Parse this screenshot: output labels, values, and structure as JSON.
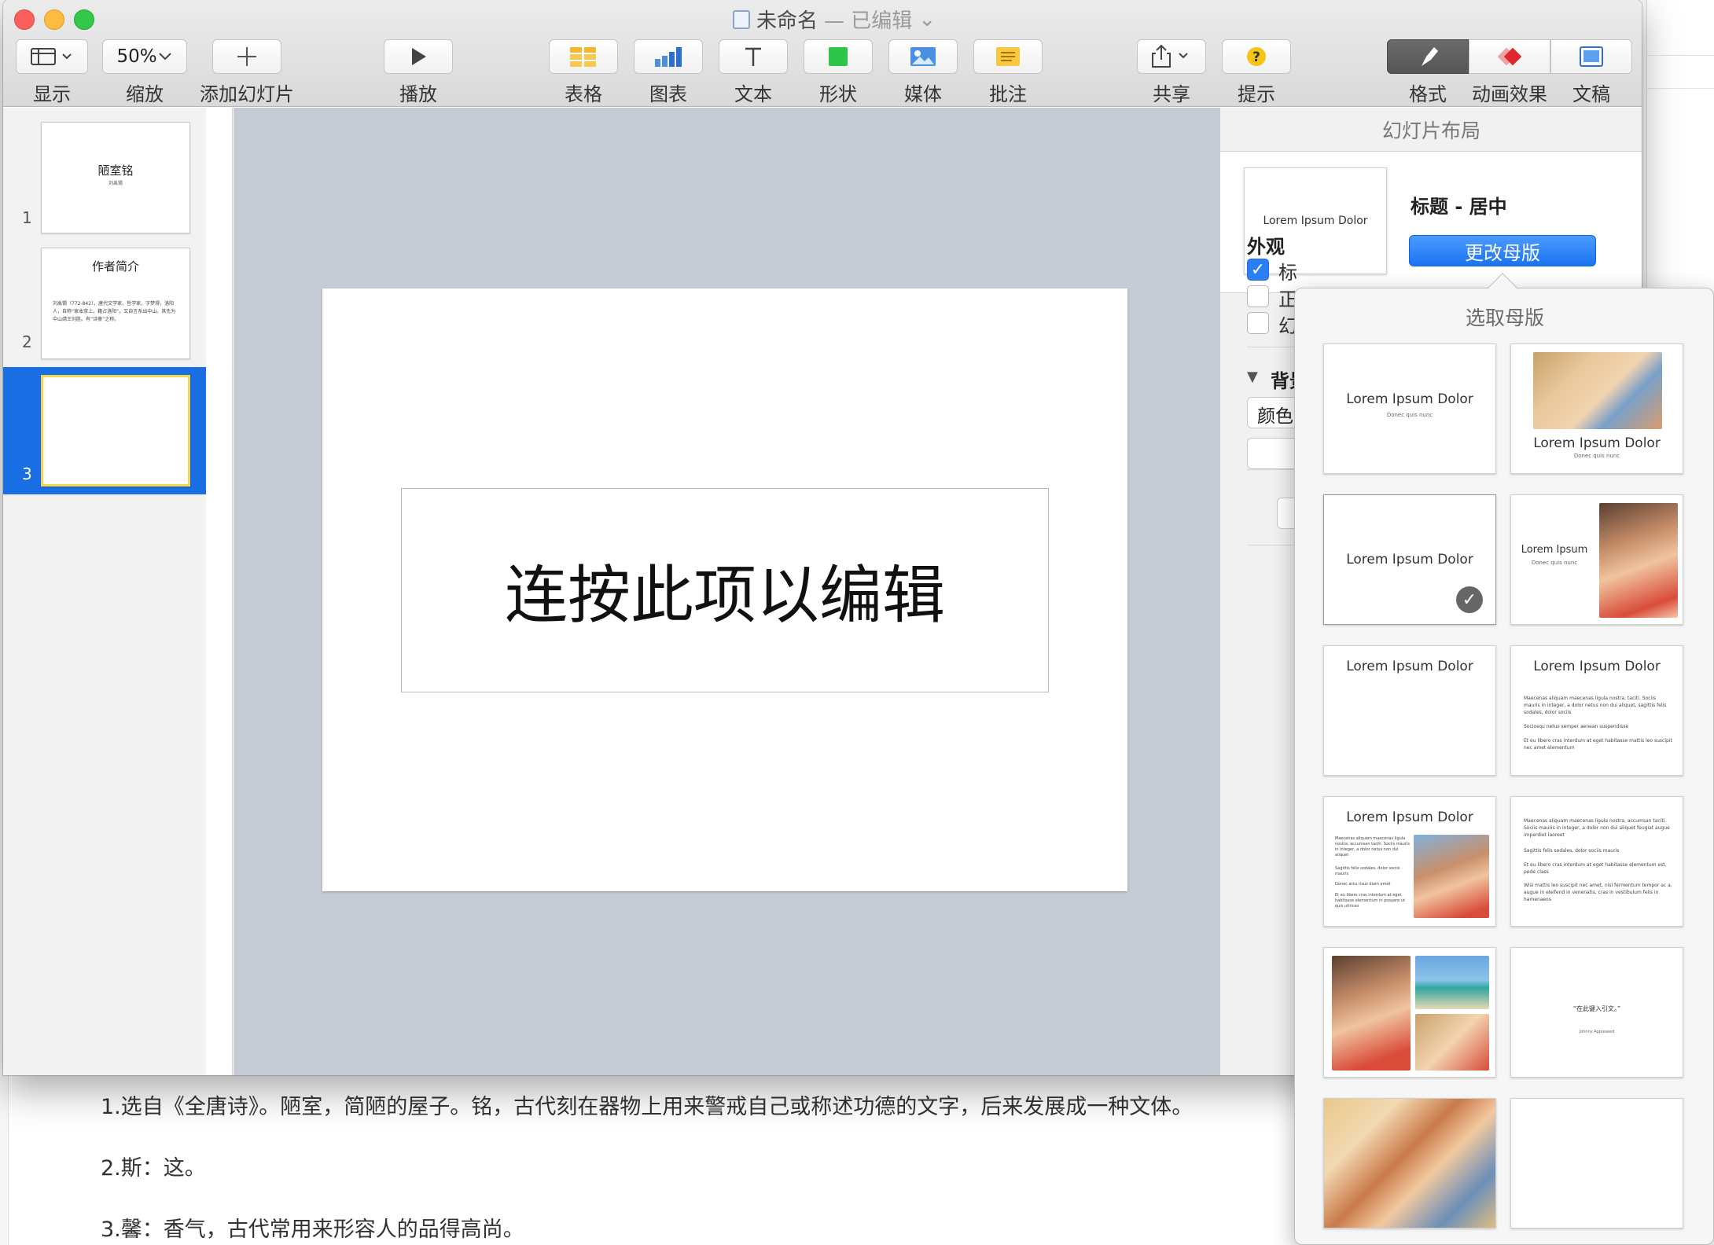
{
  "window": {
    "title": "未命名",
    "title_state": "— 已编辑",
    "title_chevron": "⌄"
  },
  "toolbar": {
    "view_label": "显示",
    "zoom_value": "50%",
    "zoom_label": "缩放",
    "add_slide_label": "添加幻灯片",
    "play_label": "播放",
    "table_label": "表格",
    "chart_label": "图表",
    "text_label": "文本",
    "shape_label": "形状",
    "media_label": "媒体",
    "comment_label": "批注",
    "share_label": "共享",
    "tips_label": "提示",
    "format_label": "格式",
    "animate_label": "动画效果",
    "document_label": "文稿"
  },
  "navigator": {
    "slides": [
      {
        "num": "1",
        "title": "陋室铭",
        "subtitle": "刘禹锡"
      },
      {
        "num": "2",
        "title": "作者简介",
        "body": "刘禹锡（772-842），唐代文学家、哲学家，字梦得，洛阳人，自称“家本荥上，籍占洛阳”，又自言系出中山。其先为中山靖王刘胜。有“诗豪”之称。"
      },
      {
        "num": "3",
        "title": "",
        "selected": true
      }
    ]
  },
  "canvas": {
    "placeholder": "连按此项以编辑"
  },
  "inspector": {
    "header": "幻灯片布局",
    "layout_thumb_text": "Lorem Ipsum Dolor",
    "layout_name": "标题 - 居中",
    "change_master_button": "更改母版",
    "appearance_heading": "外观",
    "checkbox_title": "标",
    "checkbox_body": "正",
    "checkbox_slide_num": "幻",
    "background_heading": "背景",
    "color_fill": "颜色"
  },
  "popover": {
    "title": "选取母版",
    "masters": [
      {
        "title": "Lorem Ipsum Dolor",
        "subtitle": "Donec quis nunc"
      },
      {
        "title": "Lorem Ipsum Dolor",
        "subtitle": "Donec quis nunc"
      },
      {
        "title": "Lorem Ipsum Dolor",
        "selected": true
      },
      {
        "title": "Lorem Ipsum",
        "subtitle": "Donec quis nunc"
      },
      {
        "title": "Lorem Ipsum Dolor"
      },
      {
        "title": "Lorem Ipsum Dolor",
        "bullets": [
          "Maecenas aliquam maecenas ligula nostra, taciti. Sociis mauris in integer, a dolor netus non dui aliquet, sagittis felis sodales, dolor sociis",
          "Sociosqu netus semper aenean suspendisse",
          "Et eu libero cras interdum at eget habitasse mattis leo suscipit nec amet elementum"
        ]
      },
      {
        "title": "Lorem Ipsum Dolor",
        "bullets": [
          "Maecenas aliquam maecenas ligula nostra, accumsan taciti. Sociis mauris in integer, a dolor netus non dui aliquet",
          "Sagittis felis sodales, dolor sociis mauris",
          "Donec arcu risus diam amet",
          "Et eu libero cras interdum at eget habitasse elementum in posuere ut quis ultrices"
        ]
      },
      {
        "title": "",
        "bullets": [
          "Maecenas aliquam maecenas ligula nostra, accumsan taciti. Sociis mauris in integer, a dolor non dui aliquet feugiat augue imperdiet laoreet",
          "Sagittis felis sodales, dolor sociis mauris",
          "Et eu libero cras interdum at eget habitasse elementum est, pede class",
          "Wisi mattis leo suscipit nec amet, nisl fermentum tempor ac a, augue in eleifend in venenatis, cras in vestibulum felis in hamenaeos"
        ]
      },
      {
        "title": ""
      },
      {
        "title": "",
        "quote": "“在此键入引文。”",
        "attribution": "Johnny Appleseed"
      },
      {
        "title": ""
      },
      {
        "title": ""
      }
    ]
  },
  "background_doc": {
    "notes": [
      "1.选自《全唐诗》。陋室，简陋的屋子。铭，古代刻在器物上用来警戒自己或称述功德的文字，后来发展成一种文体。",
      "2.斯：这。",
      "3.馨：香气，古代常用来形容人的品得高尚。"
    ]
  },
  "colors": {
    "accent": "#1a6ee3",
    "canvas_bg": "#c6ccd5",
    "thumb_highlight": "#f3d64a"
  }
}
